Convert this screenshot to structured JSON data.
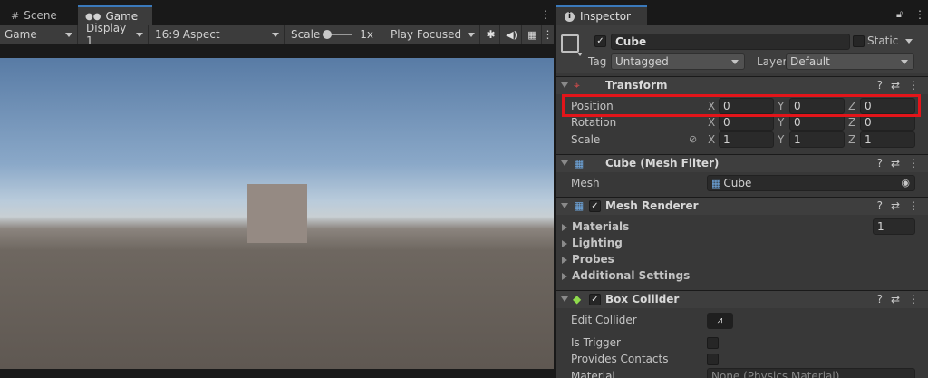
{
  "tabs": {
    "scene": "Scene",
    "game": "Game",
    "inspector": "Inspector"
  },
  "game_toolbar": {
    "mode": "Game",
    "display": "Display 1",
    "aspect": "16:9 Aspect",
    "scale_label": "Scale",
    "scale_value": "1x",
    "play_mode": "Play Focused"
  },
  "object": {
    "name": "Cube",
    "static_label": "Static",
    "tag_label": "Tag",
    "tag_value": "Untagged",
    "layer_label": "Layer",
    "layer_value": "Default"
  },
  "transform": {
    "title": "Transform",
    "position_label": "Position",
    "rotation_label": "Rotation",
    "scale_label": "Scale",
    "axes": [
      "X",
      "Y",
      "Z"
    ],
    "position": [
      "0",
      "0",
      "0"
    ],
    "rotation": [
      "0",
      "0",
      "0"
    ],
    "scale": [
      "1",
      "1",
      "1"
    ]
  },
  "mesh_filter": {
    "title": "Cube (Mesh Filter)",
    "mesh_label": "Mesh",
    "mesh_value": "Cube"
  },
  "mesh_renderer": {
    "title": "Mesh Renderer",
    "materials": "Materials",
    "materials_count": "1",
    "lighting": "Lighting",
    "probes": "Probes",
    "additional": "Additional Settings"
  },
  "box_collider": {
    "title": "Box Collider",
    "edit_collider": "Edit Collider",
    "is_trigger": "Is Trigger",
    "provides_contacts": "Provides Contacts",
    "material": "Material",
    "material_value": "None (Physics Material)"
  },
  "colors": {
    "accent": "#3a79bb",
    "highlight": "#e3151a"
  }
}
